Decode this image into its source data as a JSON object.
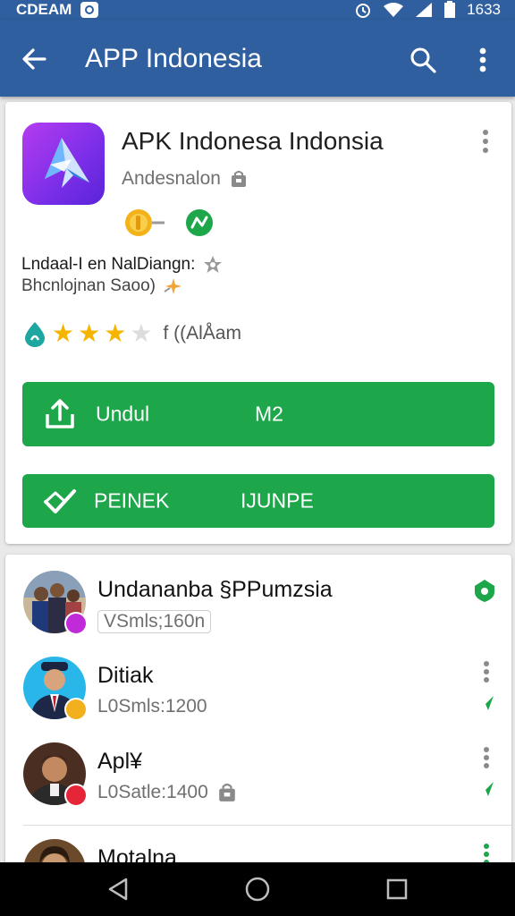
{
  "status_bar": {
    "left_text": "CDEAM",
    "time": "1633"
  },
  "app_bar": {
    "title": "APP Indonesia"
  },
  "app_card": {
    "name": "APK Indonesa Indonsia",
    "developer": "Andesnalon",
    "description_line1": "Lndaal-I en NalDiangn:",
    "description_line2": "Bhcnlojnan Saoo)",
    "rating_stars": 3,
    "rating_max": 5,
    "rating_count": "f  ((AlÅam",
    "download_button": {
      "label": "Undul",
      "size": "M2"
    },
    "verify_button": {
      "label": "PEINEK",
      "meta": "IJUNPE"
    }
  },
  "list": {
    "items": [
      {
        "title": "Undananba §PPumzsia",
        "subtitle": "VSmls;160n",
        "badge_color": "#c02ad8"
      },
      {
        "title": "Ditiak",
        "subtitle": "L0Smls:1200",
        "badge_color": "#f2b01e"
      },
      {
        "title": "Apl¥",
        "subtitle": "L0Satle:1400",
        "badge_color": "#e52638"
      },
      {
        "title": "Motalna",
        "subtitle": "",
        "badge_color": "#1ea64b"
      }
    ]
  },
  "colors": {
    "primary": "#2f5f9f",
    "accent_green": "#1ea64b",
    "star": "#f4b400"
  },
  "icons": [
    "back-arrow-icon",
    "search-icon",
    "more-vert-icon",
    "upload-icon",
    "checkmark-icon",
    "star-icon",
    "android-icon",
    "home-icon",
    "recents-icon"
  ]
}
